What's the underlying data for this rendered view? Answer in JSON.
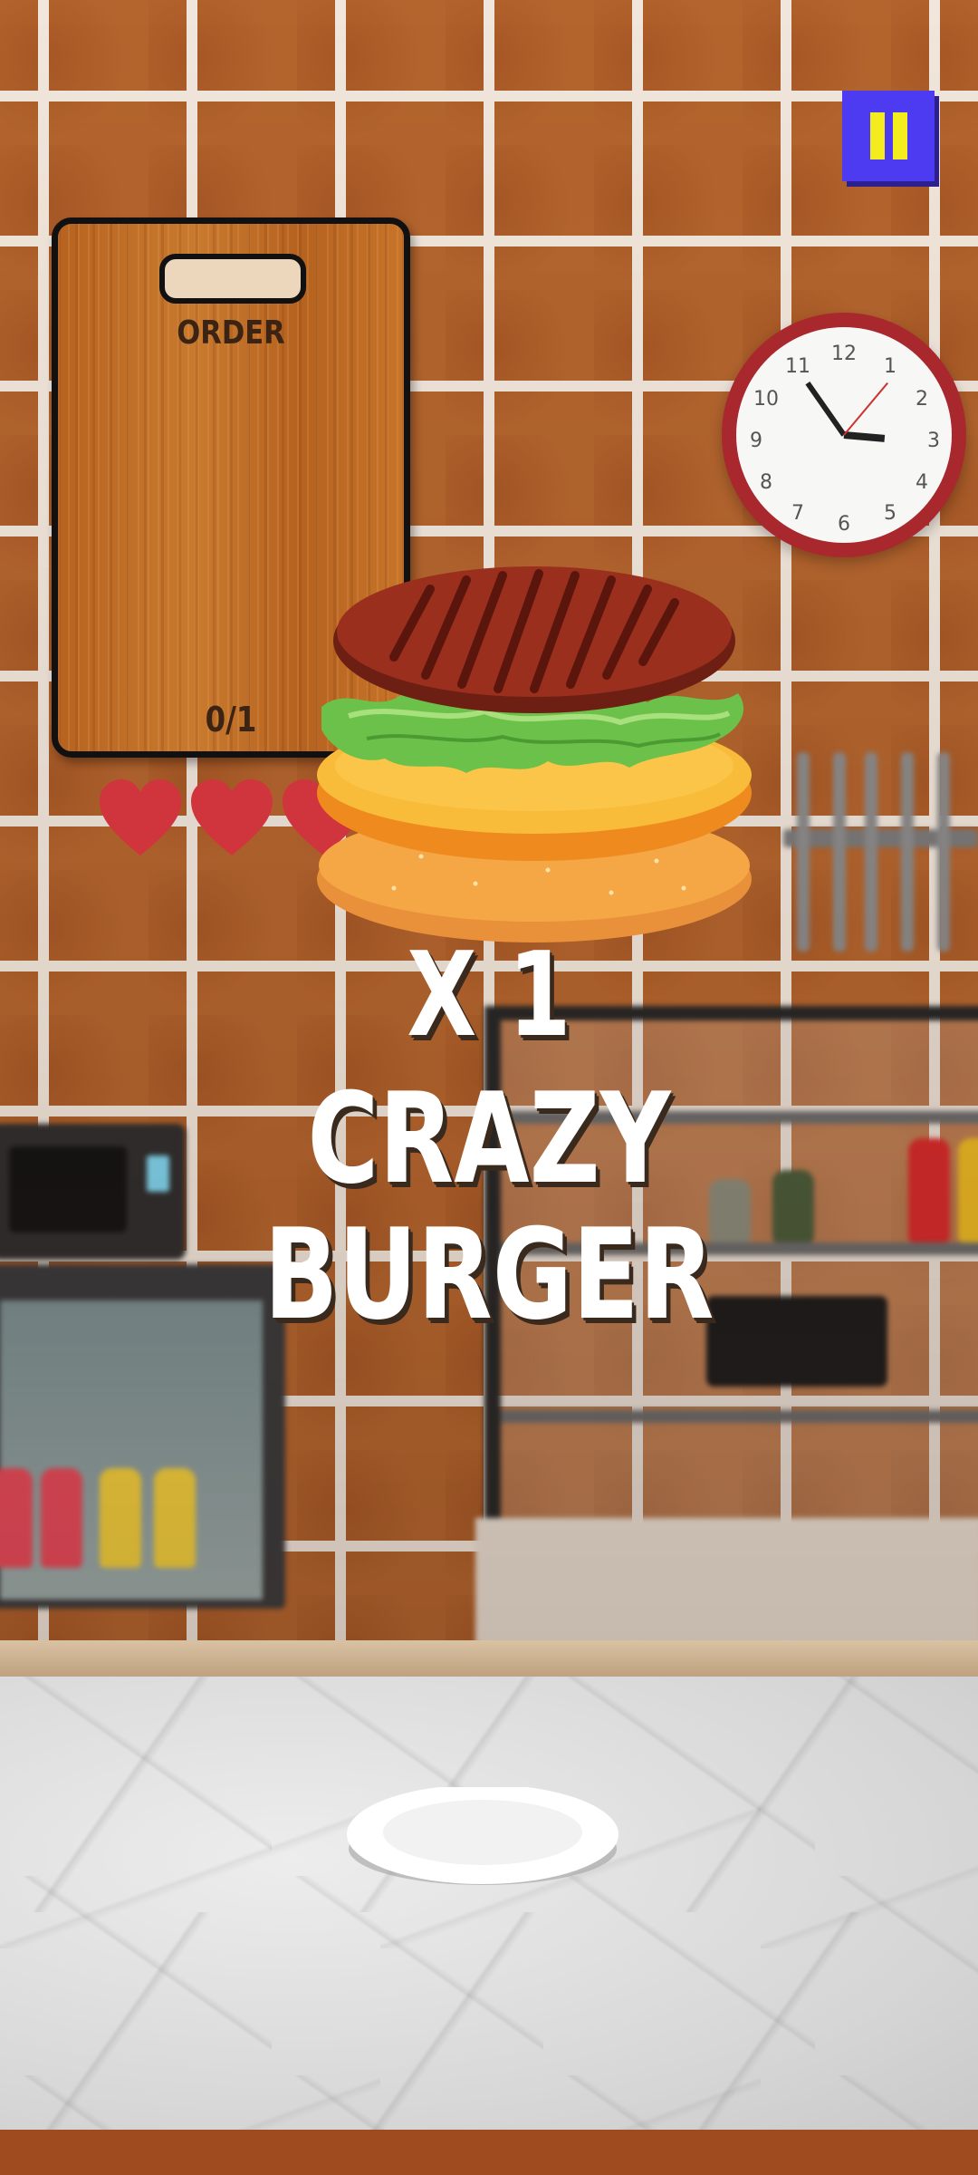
{
  "hud": {
    "pause_icon": "pause-icon",
    "pause_color": "#4d3bf2",
    "pause_glyph_color": "#f3ec1f"
  },
  "order": {
    "title": "ORDER",
    "progress": "0/1"
  },
  "lives": {
    "visible_hearts": 3,
    "heart_color": "#d0343d"
  },
  "announcement": {
    "multiplier": "X 1",
    "line1": "CRAZY",
    "line2": "BURGER"
  },
  "burger": {
    "layers": [
      "patty",
      "lettuce",
      "cheese",
      "bottom-bun"
    ]
  },
  "clock": {
    "numbers": [
      "12",
      "1",
      "2",
      "3",
      "4",
      "5",
      "6",
      "7",
      "8",
      "9",
      "10",
      "11"
    ]
  }
}
